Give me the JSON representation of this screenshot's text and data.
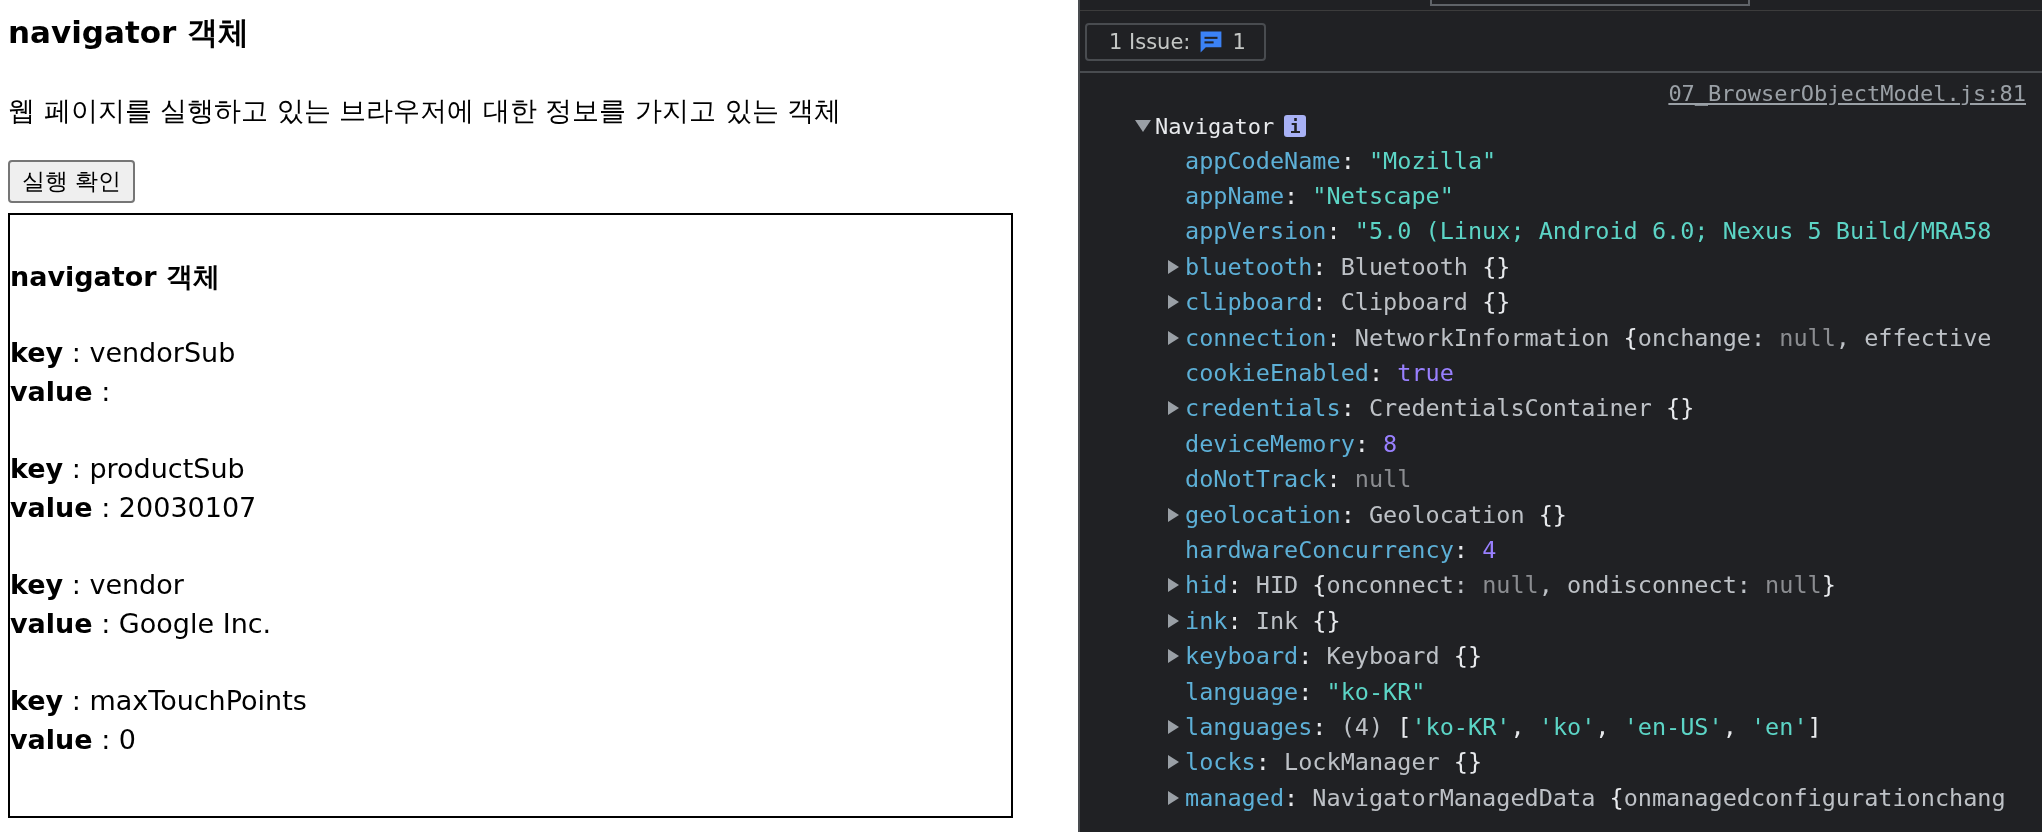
{
  "page": {
    "title": "navigator 객체",
    "description": "웹 페이지를 실행하고 있는 브라우저에 대한 정보를 가지고 있는 객체",
    "run_button": "실행 확인",
    "output": {
      "heading": "navigator 객체",
      "entries": [
        {
          "key_line": "**key** : vendorSub",
          "value_line": "**value** :"
        },
        {
          "key_line": "**key** : productSub",
          "value_line": "**value** : 20030107"
        },
        {
          "key_line": "**key** : vendor",
          "value_line": "**value** : Google Inc."
        },
        {
          "key_line": "**key** : maxTouchPoints",
          "value_line": "**value** : 0"
        }
      ]
    }
  },
  "devtools": {
    "issues_button": {
      "label": "1 Issue:",
      "count": "1"
    },
    "console": {
      "source_link": "07_BrowserObjectModel.js:81",
      "object": {
        "name": "Navigator",
        "info_badge": "i",
        "expanded": true,
        "properties": [
          {
            "key": "appCodeName",
            "expandable": false,
            "value": [
              {
                "text": ": ",
                "kind": "punct"
              },
              {
                "text": "\"Mozilla\"",
                "kind": "string"
              }
            ]
          },
          {
            "key": "appName",
            "expandable": false,
            "value": [
              {
                "text": ": ",
                "kind": "punct"
              },
              {
                "text": "\"Netscape\"",
                "kind": "string"
              }
            ]
          },
          {
            "key": "appVersion",
            "expandable": false,
            "value": [
              {
                "text": ": ",
                "kind": "punct"
              },
              {
                "text": "\"5.0 (Linux; Android 6.0; Nexus 5 Build/MRA58",
                "kind": "string"
              }
            ]
          },
          {
            "key": "bluetooth",
            "expandable": true,
            "value": [
              {
                "text": ": ",
                "kind": "punct"
              },
              {
                "text": "Bluetooth ",
                "kind": "plain"
              },
              {
                "text": "{}",
                "kind": "punct"
              }
            ]
          },
          {
            "key": "clipboard",
            "expandable": true,
            "value": [
              {
                "text": ": ",
                "kind": "punct"
              },
              {
                "text": "Clipboard ",
                "kind": "plain"
              },
              {
                "text": "{}",
                "kind": "punct"
              }
            ]
          },
          {
            "key": "connection",
            "expandable": true,
            "value": [
              {
                "text": ": ",
                "kind": "punct"
              },
              {
                "text": "NetworkInformation ",
                "kind": "plain"
              },
              {
                "text": "{",
                "kind": "punct"
              },
              {
                "text": "onchange: ",
                "kind": "plain"
              },
              {
                "text": "null",
                "kind": "null"
              },
              {
                "text": ", effective",
                "kind": "plain"
              }
            ]
          },
          {
            "key": "cookieEnabled",
            "expandable": false,
            "value": [
              {
                "text": ": ",
                "kind": "punct"
              },
              {
                "text": "true",
                "kind": "number"
              }
            ]
          },
          {
            "key": "credentials",
            "expandable": true,
            "value": [
              {
                "text": ": ",
                "kind": "punct"
              },
              {
                "text": "CredentialsContainer ",
                "kind": "plain"
              },
              {
                "text": "{}",
                "kind": "punct"
              }
            ]
          },
          {
            "key": "deviceMemory",
            "expandable": false,
            "value": [
              {
                "text": ": ",
                "kind": "punct"
              },
              {
                "text": "8",
                "kind": "number"
              }
            ]
          },
          {
            "key": "doNotTrack",
            "expandable": false,
            "value": [
              {
                "text": ": ",
                "kind": "punct"
              },
              {
                "text": "null",
                "kind": "null"
              }
            ]
          },
          {
            "key": "geolocation",
            "expandable": true,
            "value": [
              {
                "text": ": ",
                "kind": "punct"
              },
              {
                "text": "Geolocation ",
                "kind": "plain"
              },
              {
                "text": "{}",
                "kind": "punct"
              }
            ]
          },
          {
            "key": "hardwareConcurrency",
            "expandable": false,
            "value": [
              {
                "text": ": ",
                "kind": "punct"
              },
              {
                "text": "4",
                "kind": "number"
              }
            ]
          },
          {
            "key": "hid",
            "expandable": true,
            "value": [
              {
                "text": ": ",
                "kind": "punct"
              },
              {
                "text": "HID ",
                "kind": "plain"
              },
              {
                "text": "{",
                "kind": "punct"
              },
              {
                "text": "onconnect: ",
                "kind": "plain"
              },
              {
                "text": "null",
                "kind": "null"
              },
              {
                "text": ", ondisconnect: ",
                "kind": "plain"
              },
              {
                "text": "null",
                "kind": "null"
              },
              {
                "text": "}",
                "kind": "punct"
              }
            ]
          },
          {
            "key": "ink",
            "expandable": true,
            "value": [
              {
                "text": ": ",
                "kind": "punct"
              },
              {
                "text": "Ink ",
                "kind": "plain"
              },
              {
                "text": "{}",
                "kind": "punct"
              }
            ]
          },
          {
            "key": "keyboard",
            "expandable": true,
            "value": [
              {
                "text": ": ",
                "kind": "punct"
              },
              {
                "text": "Keyboard ",
                "kind": "plain"
              },
              {
                "text": "{}",
                "kind": "punct"
              }
            ]
          },
          {
            "key": "language",
            "expandable": false,
            "value": [
              {
                "text": ": ",
                "kind": "punct"
              },
              {
                "text": "\"ko-KR\"",
                "kind": "string"
              }
            ]
          },
          {
            "key": "languages",
            "expandable": true,
            "value": [
              {
                "text": ": ",
                "kind": "punct"
              },
              {
                "text": "(4) ",
                "kind": "plain"
              },
              {
                "text": "[",
                "kind": "punct"
              },
              {
                "text": "'ko-KR'",
                "kind": "string"
              },
              {
                "text": ", ",
                "kind": "punct"
              },
              {
                "text": "'ko'",
                "kind": "string"
              },
              {
                "text": ", ",
                "kind": "punct"
              },
              {
                "text": "'en-US'",
                "kind": "string"
              },
              {
                "text": ", ",
                "kind": "punct"
              },
              {
                "text": "'en'",
                "kind": "string"
              },
              {
                "text": "]",
                "kind": "punct"
              }
            ]
          },
          {
            "key": "locks",
            "expandable": true,
            "value": [
              {
                "text": ": ",
                "kind": "punct"
              },
              {
                "text": "LockManager ",
                "kind": "plain"
              },
              {
                "text": "{}",
                "kind": "punct"
              }
            ]
          },
          {
            "key": "managed",
            "expandable": true,
            "value": [
              {
                "text": ": ",
                "kind": "punct"
              },
              {
                "text": "NavigatorManagedData ",
                "kind": "plain"
              },
              {
                "text": "{",
                "kind": "punct"
              },
              {
                "text": "onmanagedconfigurationchang",
                "kind": "plain"
              }
            ]
          }
        ]
      }
    }
  }
}
